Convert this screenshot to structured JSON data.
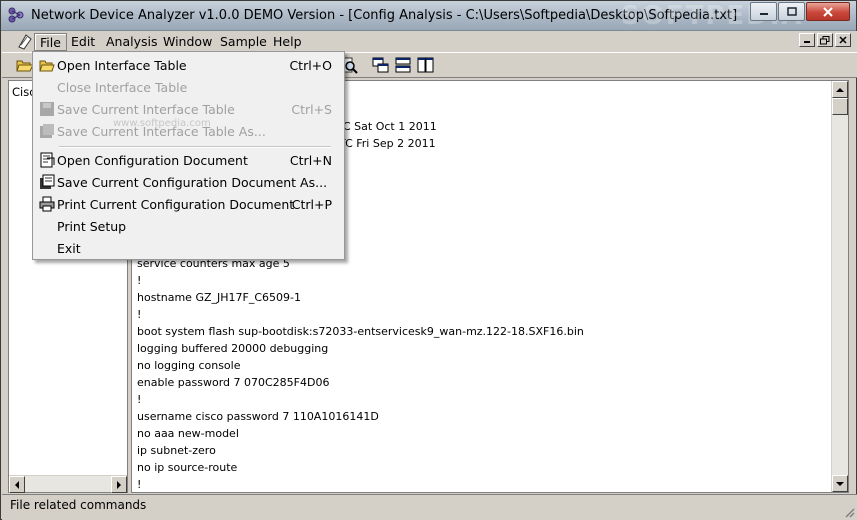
{
  "window": {
    "title": "Network Device Analyzer v1.0.0 DEMO Version - [Config Analysis - C:\\Users\\Softpedia\\Desktop\\Softpedia.txt]",
    "watermark": "SOFTPEDIA"
  },
  "menubar": {
    "items": [
      "File",
      "Edit",
      "Analysis",
      "Window",
      "Sample",
      "Help"
    ]
  },
  "left_pane": {
    "text": "Cisc"
  },
  "document": {
    "lines": [
      {
        "text": "C Sat Oct 1 2011"
      },
      {
        "text": "TC Fri Sep 2 2011"
      },
      {
        "text": "service counters max age 5"
      },
      {
        "text": "!"
      },
      {
        "text": "hostname GZ_JH17F_C6509-1"
      },
      {
        "text": "!"
      },
      {
        "text": "boot system flash sup-bootdisk:s72033-entservicesk9_wan-mz.122-18.SXF16.bin"
      },
      {
        "text": "logging buffered 20000 debugging"
      },
      {
        "text": "no logging console"
      },
      {
        "text": "enable password 7 070C285F4D06"
      },
      {
        "text": "!"
      },
      {
        "text": "username cisco password 7 110A1016141D"
      },
      {
        "text": "no aaa new-model"
      },
      {
        "text": "ip subnet-zero"
      },
      {
        "text": "no ip source-route"
      },
      {
        "text": "!"
      }
    ]
  },
  "file_menu": {
    "watermark": "www.softpedia.com",
    "items": [
      {
        "label": "Open Interface Table",
        "shortcut": "Ctrl+O",
        "icon": "open-folder-icon",
        "disabled": false
      },
      {
        "label": "Close Interface Table",
        "shortcut": "",
        "icon": "",
        "disabled": true
      },
      {
        "label": "Save Current Interface Table",
        "shortcut": "Ctrl+S",
        "icon": "save-icon",
        "disabled": true
      },
      {
        "label": "Save Current Interface Table As...",
        "shortcut": "",
        "icon": "save-as-icon",
        "disabled": true
      },
      {
        "label": "Open Configuration Document",
        "shortcut": "Ctrl+N",
        "icon": "open-document-icon",
        "disabled": false
      },
      {
        "label": "Save Current Configuration Document As...",
        "shortcut": "",
        "icon": "save-document-icon",
        "disabled": false
      },
      {
        "label": "Print Current Configuration Document",
        "shortcut": "Ctrl+P",
        "icon": "printer-icon",
        "disabled": false
      },
      {
        "label": "Print Setup",
        "shortcut": "",
        "icon": "",
        "disabled": false
      },
      {
        "label": "Exit",
        "shortcut": "",
        "icon": "",
        "disabled": false
      }
    ]
  },
  "statusbar": {
    "text": "File related commands"
  },
  "colors": {
    "menu_bg": "#f0f0f0",
    "window_face": "#d4d0c8",
    "title_bar": "#a9b6c4",
    "close_button": "#c9483a"
  }
}
